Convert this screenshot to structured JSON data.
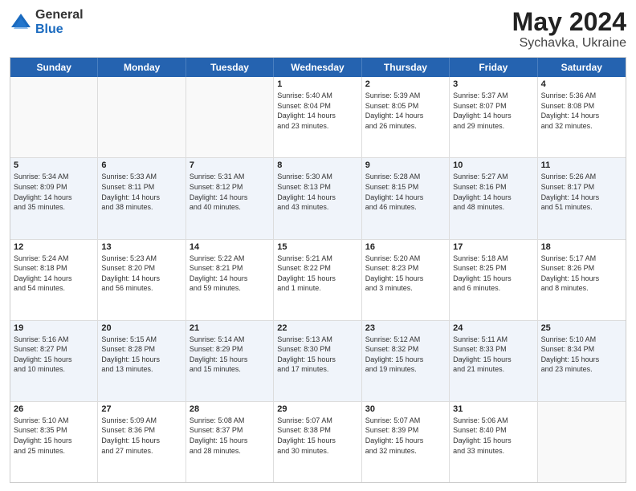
{
  "logo": {
    "general": "General",
    "blue": "Blue"
  },
  "title": {
    "month": "May 2024",
    "location": "Sychavka, Ukraine"
  },
  "calendar": {
    "headers": [
      "Sunday",
      "Monday",
      "Tuesday",
      "Wednesday",
      "Thursday",
      "Friday",
      "Saturday"
    ],
    "weeks": [
      [
        {
          "day": "",
          "info": ""
        },
        {
          "day": "",
          "info": ""
        },
        {
          "day": "",
          "info": ""
        },
        {
          "day": "1",
          "info": "Sunrise: 5:40 AM\nSunset: 8:04 PM\nDaylight: 14 hours\nand 23 minutes."
        },
        {
          "day": "2",
          "info": "Sunrise: 5:39 AM\nSunset: 8:05 PM\nDaylight: 14 hours\nand 26 minutes."
        },
        {
          "day": "3",
          "info": "Sunrise: 5:37 AM\nSunset: 8:07 PM\nDaylight: 14 hours\nand 29 minutes."
        },
        {
          "day": "4",
          "info": "Sunrise: 5:36 AM\nSunset: 8:08 PM\nDaylight: 14 hours\nand 32 minutes."
        }
      ],
      [
        {
          "day": "5",
          "info": "Sunrise: 5:34 AM\nSunset: 8:09 PM\nDaylight: 14 hours\nand 35 minutes."
        },
        {
          "day": "6",
          "info": "Sunrise: 5:33 AM\nSunset: 8:11 PM\nDaylight: 14 hours\nand 38 minutes."
        },
        {
          "day": "7",
          "info": "Sunrise: 5:31 AM\nSunset: 8:12 PM\nDaylight: 14 hours\nand 40 minutes."
        },
        {
          "day": "8",
          "info": "Sunrise: 5:30 AM\nSunset: 8:13 PM\nDaylight: 14 hours\nand 43 minutes."
        },
        {
          "day": "9",
          "info": "Sunrise: 5:28 AM\nSunset: 8:15 PM\nDaylight: 14 hours\nand 46 minutes."
        },
        {
          "day": "10",
          "info": "Sunrise: 5:27 AM\nSunset: 8:16 PM\nDaylight: 14 hours\nand 48 minutes."
        },
        {
          "day": "11",
          "info": "Sunrise: 5:26 AM\nSunset: 8:17 PM\nDaylight: 14 hours\nand 51 minutes."
        }
      ],
      [
        {
          "day": "12",
          "info": "Sunrise: 5:24 AM\nSunset: 8:18 PM\nDaylight: 14 hours\nand 54 minutes."
        },
        {
          "day": "13",
          "info": "Sunrise: 5:23 AM\nSunset: 8:20 PM\nDaylight: 14 hours\nand 56 minutes."
        },
        {
          "day": "14",
          "info": "Sunrise: 5:22 AM\nSunset: 8:21 PM\nDaylight: 14 hours\nand 59 minutes."
        },
        {
          "day": "15",
          "info": "Sunrise: 5:21 AM\nSunset: 8:22 PM\nDaylight: 15 hours\nand 1 minute."
        },
        {
          "day": "16",
          "info": "Sunrise: 5:20 AM\nSunset: 8:23 PM\nDaylight: 15 hours\nand 3 minutes."
        },
        {
          "day": "17",
          "info": "Sunrise: 5:18 AM\nSunset: 8:25 PM\nDaylight: 15 hours\nand 6 minutes."
        },
        {
          "day": "18",
          "info": "Sunrise: 5:17 AM\nSunset: 8:26 PM\nDaylight: 15 hours\nand 8 minutes."
        }
      ],
      [
        {
          "day": "19",
          "info": "Sunrise: 5:16 AM\nSunset: 8:27 PM\nDaylight: 15 hours\nand 10 minutes."
        },
        {
          "day": "20",
          "info": "Sunrise: 5:15 AM\nSunset: 8:28 PM\nDaylight: 15 hours\nand 13 minutes."
        },
        {
          "day": "21",
          "info": "Sunrise: 5:14 AM\nSunset: 8:29 PM\nDaylight: 15 hours\nand 15 minutes."
        },
        {
          "day": "22",
          "info": "Sunrise: 5:13 AM\nSunset: 8:30 PM\nDaylight: 15 hours\nand 17 minutes."
        },
        {
          "day": "23",
          "info": "Sunrise: 5:12 AM\nSunset: 8:32 PM\nDaylight: 15 hours\nand 19 minutes."
        },
        {
          "day": "24",
          "info": "Sunrise: 5:11 AM\nSunset: 8:33 PM\nDaylight: 15 hours\nand 21 minutes."
        },
        {
          "day": "25",
          "info": "Sunrise: 5:10 AM\nSunset: 8:34 PM\nDaylight: 15 hours\nand 23 minutes."
        }
      ],
      [
        {
          "day": "26",
          "info": "Sunrise: 5:10 AM\nSunset: 8:35 PM\nDaylight: 15 hours\nand 25 minutes."
        },
        {
          "day": "27",
          "info": "Sunrise: 5:09 AM\nSunset: 8:36 PM\nDaylight: 15 hours\nand 27 minutes."
        },
        {
          "day": "28",
          "info": "Sunrise: 5:08 AM\nSunset: 8:37 PM\nDaylight: 15 hours\nand 28 minutes."
        },
        {
          "day": "29",
          "info": "Sunrise: 5:07 AM\nSunset: 8:38 PM\nDaylight: 15 hours\nand 30 minutes."
        },
        {
          "day": "30",
          "info": "Sunrise: 5:07 AM\nSunset: 8:39 PM\nDaylight: 15 hours\nand 32 minutes."
        },
        {
          "day": "31",
          "info": "Sunrise: 5:06 AM\nSunset: 8:40 PM\nDaylight: 15 hours\nand 33 minutes."
        },
        {
          "day": "",
          "info": ""
        }
      ]
    ]
  }
}
